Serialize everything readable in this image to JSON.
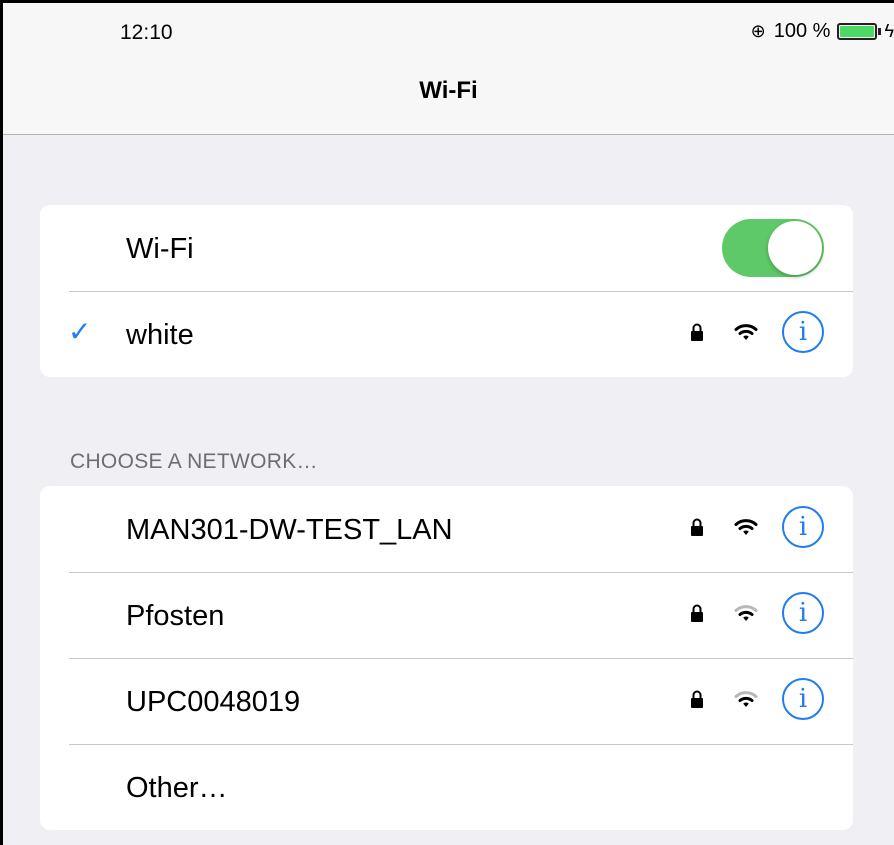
{
  "status_bar": {
    "time": "12:10",
    "rotation_lock_icon": "rotation-lock-icon",
    "battery_percent": "100 %",
    "battery_level": 1.0,
    "charging_icon": "bolt-icon"
  },
  "nav": {
    "title": "Wi-Fi"
  },
  "wifi_toggle": {
    "label": "Wi-Fi",
    "on": true,
    "color": "#5ec968"
  },
  "connected": {
    "check": "✓",
    "name": "white",
    "secured": true,
    "signal_bars": 3
  },
  "choose_section": {
    "header": "CHOOSE A NETWORK…"
  },
  "networks": [
    {
      "name": "MAN301-DW-TEST_LAN",
      "secured": true,
      "signal_bars": 3
    },
    {
      "name": "Pfosten",
      "secured": true,
      "signal_bars": 2
    },
    {
      "name": "UPC0048019",
      "secured": true,
      "signal_bars": 2
    }
  ],
  "other": {
    "label": "Other…"
  },
  "info_glyph": "i",
  "accent_color": "#1f7cf2"
}
